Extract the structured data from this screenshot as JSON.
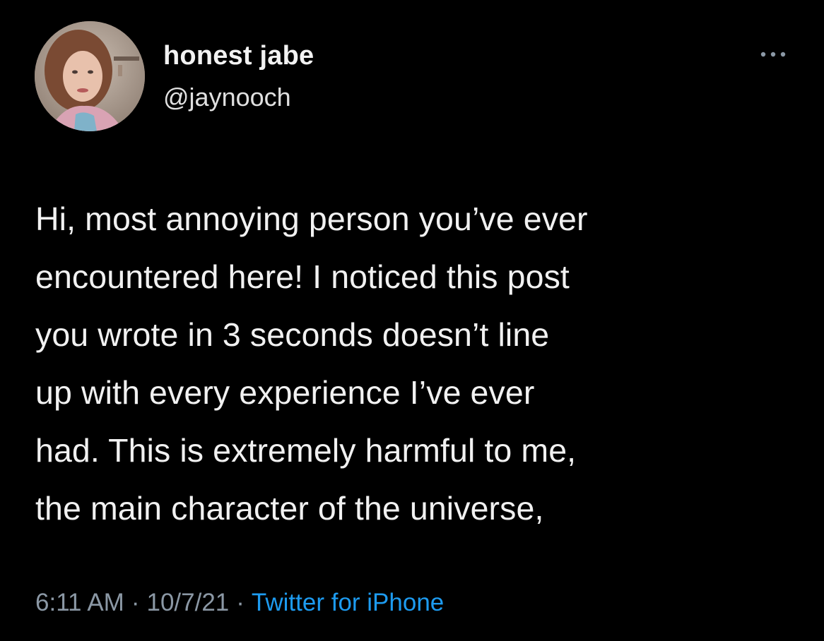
{
  "tweet": {
    "author": {
      "display_name": "honest jabe",
      "handle": "@jaynooch",
      "avatar_icon": "profile-photo"
    },
    "more_icon": "ellipsis-icon",
    "body_lines": [
      "Hi, most annoying person you’ve ever",
      "encountered here! I noticed this post",
      "you wrote in 3 seconds doesn’t line",
      "up with every experience I’ve ever",
      "had. This is extremely harmful to me,",
      "the main character of the universe,"
    ],
    "meta": {
      "time": "6:11 AM",
      "separator": "·",
      "date": "10/7/21",
      "source": "Twitter for iPhone"
    }
  },
  "colors": {
    "background": "#000000",
    "text": "#f1f1f1",
    "meta_text": "#8b98a5",
    "link": "#1d9bf0"
  }
}
